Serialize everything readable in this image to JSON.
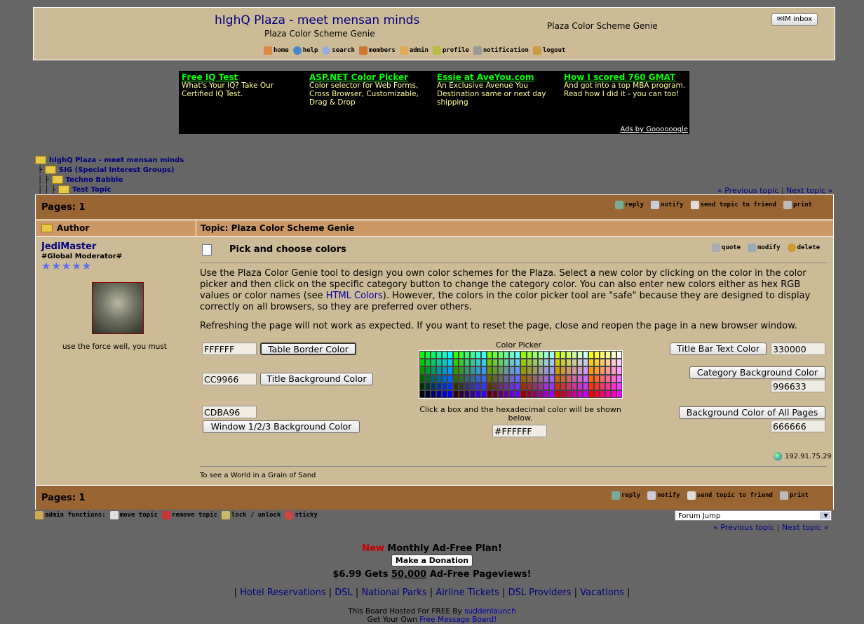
{
  "header": {
    "site_title": "hIghQ Plaza - meet mensan minds",
    "subtitle": "Plaza Color Scheme Genie",
    "page_name": "Plaza Color Scheme Genie",
    "im_inbox": "IM inbox"
  },
  "nav": {
    "items": [
      "home",
      "help",
      "search",
      "members",
      "admin",
      "profile",
      "notification",
      "logout"
    ]
  },
  "ads": [
    {
      "title": "Free IQ Test",
      "text": "What's Your IQ? Take Our Certified IQ Test."
    },
    {
      "title": "ASP.NET Color Picker",
      "text": "Color selector for Web Forms, Cross Browser, Customizable, Drag & Drop"
    },
    {
      "title": "Essie at AveYou.com",
      "text": "An Exclusive Avenue You Destination same or next day shipping"
    },
    {
      "title": "How I scored 760 GMAT",
      "text": "And got into a top MBA program. Read how I did it - you can too!"
    }
  ],
  "ads_by": "Ads by Goooooogle",
  "breadcrumb": [
    "hIghQ Plaza - meet mensan minds",
    "SIG (Special Interest Groups)",
    "Techno Babble",
    "Test Topic"
  ],
  "topic_nav": {
    "prev": "« Previous topic",
    "sep": " | ",
    "next": "Next topic »"
  },
  "pages_label": "Pages: 1",
  "topic_buttons": [
    "reply",
    "notify",
    "send topic to friend",
    "print"
  ],
  "header_row": {
    "author": "Author",
    "topic": "Topic: Plaza Color Scheme Genie"
  },
  "post": {
    "username": "JediMaster",
    "rank": "#Global Moderator#",
    "stars": "★★★★★",
    "user_quote": "use the force well, you must",
    "title": "Pick and choose colors",
    "actions": [
      "quote",
      "modify",
      "delete"
    ],
    "body1_a": "Use the Plaza Color Genie tool to design you own color schemes for the Plaza. Select a new color by clicking on the color in the color picker and then click on the specific category button to change the category color. You can also enter new colors either as hex RGB values or color names (see ",
    "body1_link": "HTML Colors",
    "body1_b": "). However, the colors in the color picker tool are \"safe\" because they are designed to display correctly on all browsers, so they are preferred over others.",
    "body2": "Refreshing the page will not work as expected. If you want to reset the page, close and reopen the page in a new browser window.",
    "ip": "192.91.75.29",
    "signature": "To see a World in a Grain of Sand"
  },
  "genie": {
    "table_border_value": "FFFFFF",
    "table_border_btn": "Table Border Color",
    "title_bg_value": "CC9966",
    "title_bg_btn": "Title Background Color",
    "window_bg_value": "CDBA96",
    "window_bg_btn": "Window 1/2/3 Background Color",
    "picker_title": "Color Picker",
    "picker_instr": "Click a box and the hexadecimal color will be shown below.",
    "picked_value": "#FFFFFF",
    "title_text_btn": "Title Bar Text Color",
    "title_text_value": "330000",
    "category_bg_btn": "Category Background Color",
    "category_bg_value": "996633",
    "page_bg_btn": "Background Color of All Pages",
    "page_bg_value": "666666"
  },
  "admin_functions": [
    "admin functions:",
    "move topic",
    "remove topic",
    "lock / unlock",
    "sticky"
  ],
  "forum_jump": "Forum Jump",
  "footer": {
    "new": "New",
    "plan": " Monthly Ad-Free Plan!",
    "donate": "Make a Donation",
    "price_a": "$6.99 Gets ",
    "price_b": "50,000",
    "price_c": " Ad-Free Pageviews!",
    "links": [
      "Hotel Reservations",
      "DSL",
      "National Parks",
      "Airline Tickets",
      "DSL Providers",
      "Vacations"
    ],
    "hosted_a": "This Board Hosted For FREE By ",
    "hosted_link": "suddenlaunch",
    "own_a": "Get Your Own ",
    "own_link": "Free Message Board!"
  },
  "colors": {
    "window_bg": "#CDBA96",
    "title_bg": "#CC9966",
    "category_bg": "#996633",
    "page_bg": "#666666"
  }
}
